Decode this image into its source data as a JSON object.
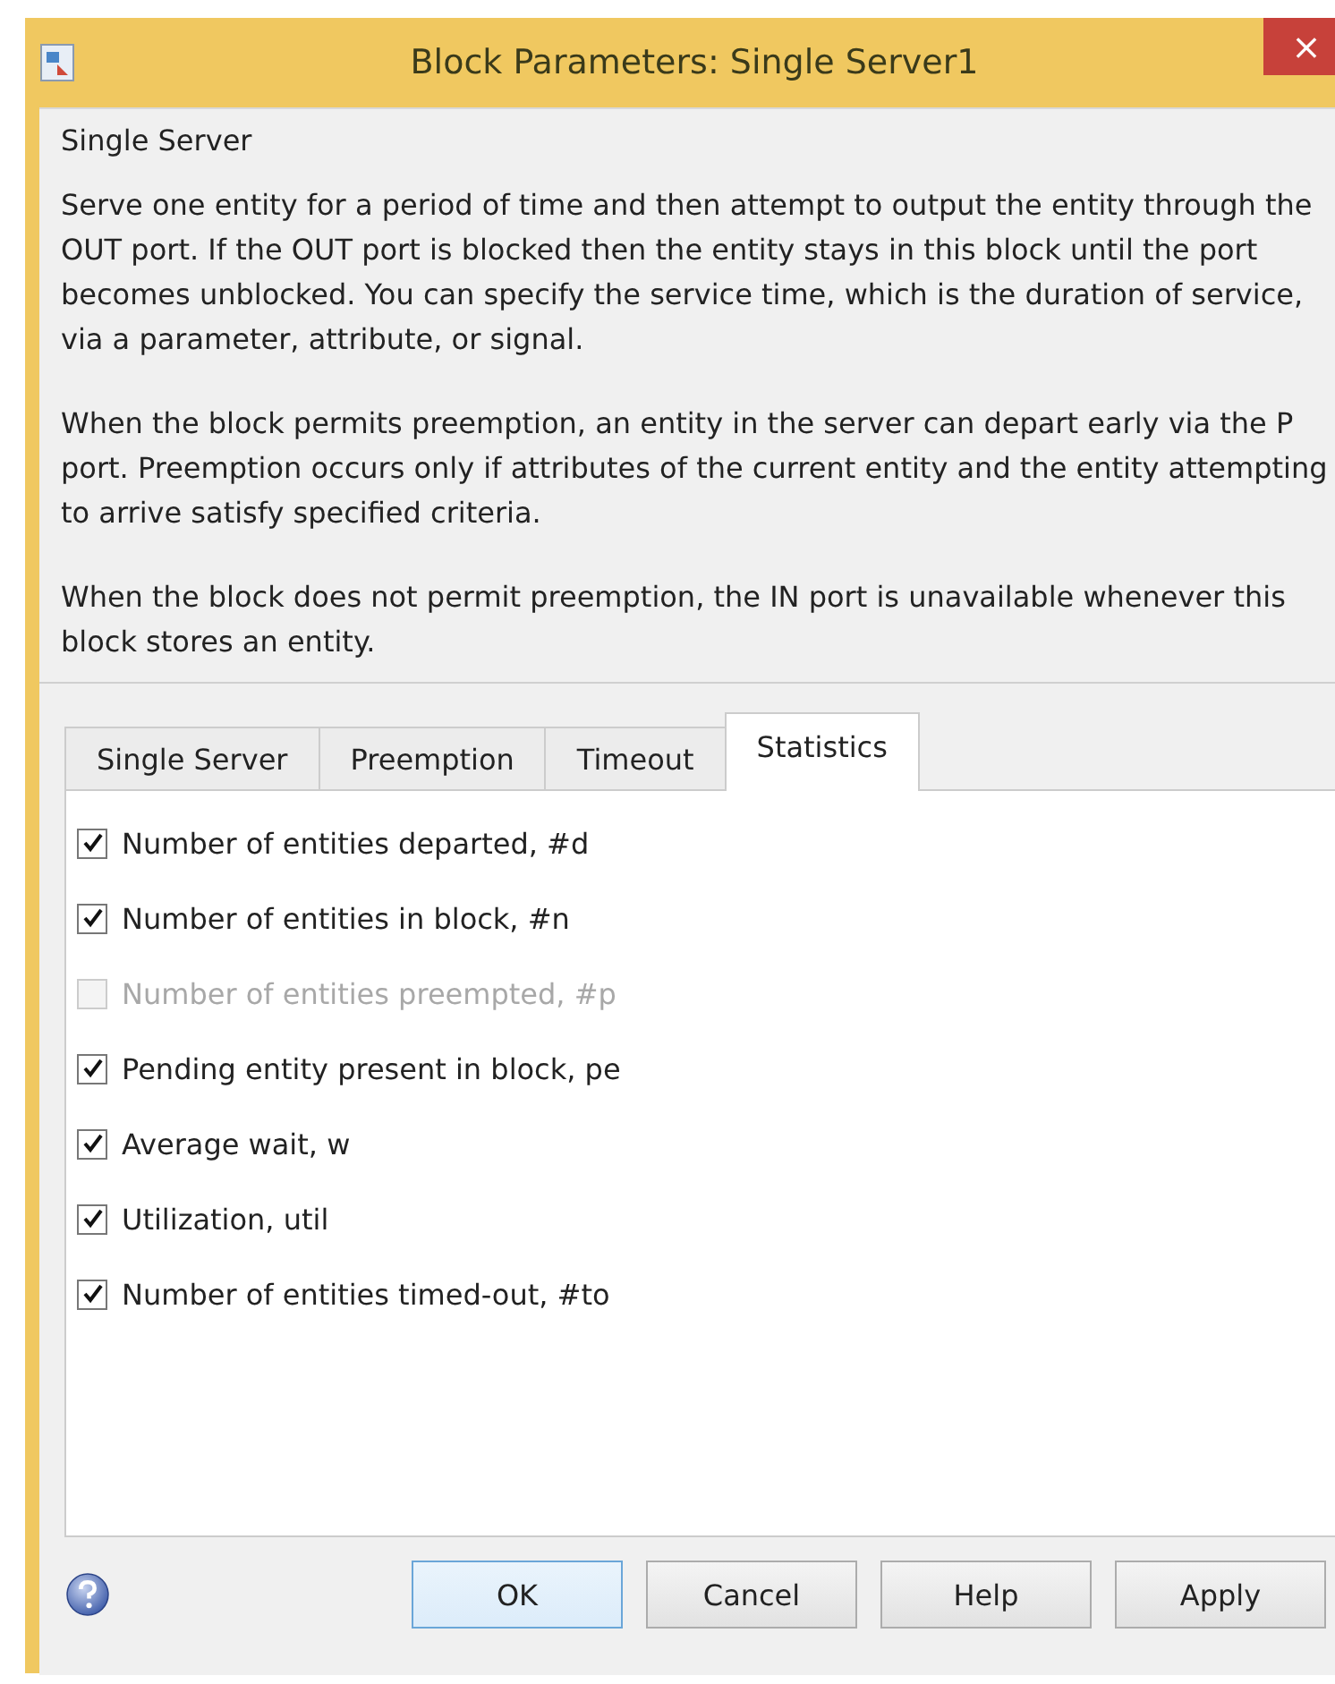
{
  "window": {
    "title": "Block Parameters: Single Server1",
    "close": "×"
  },
  "block_name": "Single Server",
  "description": [
    "Serve one entity for a period of time and then attempt to output the entity through the OUT port. If the OUT port is blocked then the entity stays in this block until the port becomes unblocked. You can specify the service time, which is the duration of service, via a parameter, attribute, or signal.",
    "When the block permits preemption, an entity in the server can depart early via the P port. Preemption occurs only if attributes of the current entity and the entity attempting to arrive satisfy specified criteria.",
    "When the block does not permit preemption, the IN port is unavailable whenever this block stores an entity."
  ],
  "tabs": [
    {
      "label": "Single Server",
      "selected": false
    },
    {
      "label": "Preemption",
      "selected": false
    },
    {
      "label": "Timeout",
      "selected": false
    },
    {
      "label": "Statistics",
      "selected": true
    }
  ],
  "options": [
    {
      "label": "Number of entities departed, #d",
      "checked": true,
      "disabled": false
    },
    {
      "label": "Number of entities in block, #n",
      "checked": true,
      "disabled": false
    },
    {
      "label": "Number of entities preempted, #p",
      "checked": false,
      "disabled": true
    },
    {
      "label": "Pending entity present in block, pe",
      "checked": true,
      "disabled": false
    },
    {
      "label": "Average wait, w",
      "checked": true,
      "disabled": false
    },
    {
      "label": "Utilization, util",
      "checked": true,
      "disabled": false
    },
    {
      "label": "Number of entities timed-out, #to",
      "checked": true,
      "disabled": false
    }
  ],
  "buttons": [
    {
      "label": "OK",
      "default": true
    },
    {
      "label": "Cancel",
      "default": false
    },
    {
      "label": "Help",
      "default": false
    },
    {
      "label": "Apply",
      "default": false
    }
  ]
}
